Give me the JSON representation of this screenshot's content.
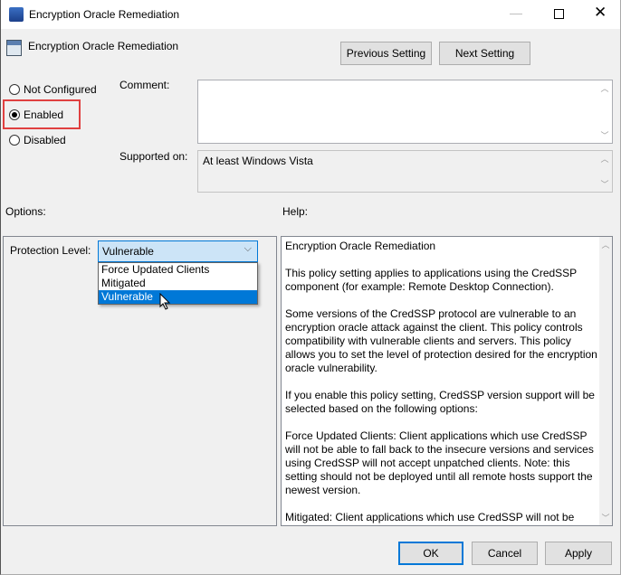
{
  "window": {
    "title": "Encryption Oracle Remediation",
    "controls": [
      "minimize",
      "maximize",
      "close"
    ]
  },
  "header": {
    "title": "Encryption Oracle Remediation",
    "previous_label": "Previous Setting",
    "next_label": "Next Setting"
  },
  "state": {
    "options": [
      "Not Configured",
      "Enabled",
      "Disabled"
    ],
    "selected": "Enabled",
    "highlight_color": "#e04040"
  },
  "comment": {
    "label": "Comment:",
    "value": ""
  },
  "supported": {
    "label": "Supported on:",
    "value": "At least Windows Vista"
  },
  "options_label": "Options:",
  "help_label": "Help:",
  "protection": {
    "label": "Protection Level:",
    "value": "Vulnerable",
    "items": [
      "Force Updated Clients",
      "Mitigated",
      "Vulnerable"
    ],
    "highlighted": "Vulnerable"
  },
  "help": {
    "paragraphs": [
      "Encryption Oracle Remediation",
      "This policy setting applies to applications using the CredSSP component (for example: Remote Desktop Connection).",
      "Some versions of the CredSSP protocol are vulnerable to an encryption oracle attack against the client.  This policy controls compatibility with vulnerable clients and servers.  This policy allows you to set the level of protection desired for the encryption oracle vulnerability.",
      "If you enable this policy setting, CredSSP version support will be selected based on the following options:",
      "Force Updated Clients: Client applications which use CredSSP will not be able to fall back to the insecure versions and services using CredSSP will not accept unpatched clients. Note: this setting should not be deployed until all remote hosts support the newest version.",
      "Mitigated: Client applications which use CredSSP will not be able to fall back to the insecure versions but services using CredSSP will accept unpatched clients."
    ]
  },
  "footer": {
    "ok": "OK",
    "cancel": "Cancel",
    "apply": "Apply"
  }
}
